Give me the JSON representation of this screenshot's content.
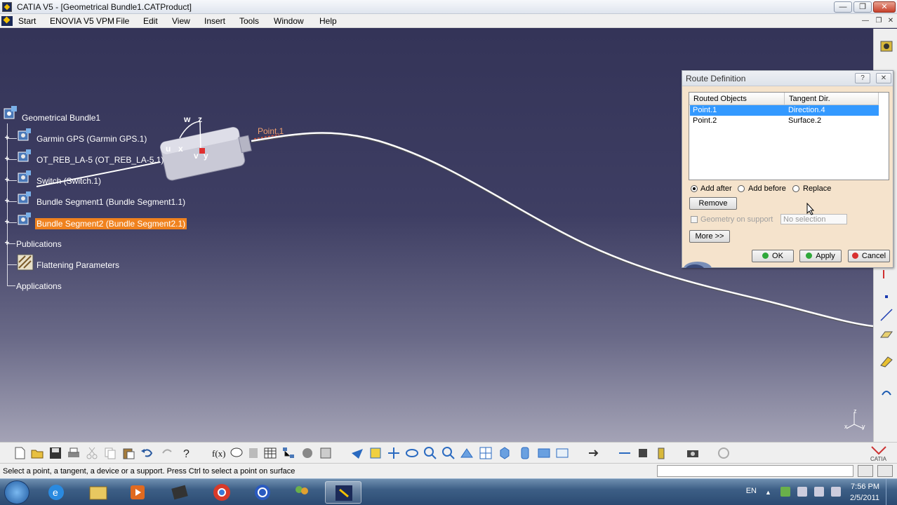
{
  "window": {
    "title": "CATIA V5 - [Geometrical Bundle1.CATProduct]",
    "minimize_glyph": "—",
    "restore_glyph": "❐",
    "close_glyph": "✕"
  },
  "menu": {
    "items": [
      "Start",
      "ENOVIA V5 VPM",
      "File",
      "Edit",
      "View",
      "Insert",
      "Tools",
      "Window",
      "Help"
    ],
    "mdi_min": "—",
    "mdi_restore": "❐",
    "mdi_close": "✕"
  },
  "tree": {
    "root": "Geometrical Bundle1",
    "nodes": [
      "Garmin GPS (Garmin GPS.1)",
      "OT_REB_LA-5 (OT_REB_LA-5.1)",
      "Switch (Switch.1)",
      "Bundle Segment1 (Bundle Segment1.1)",
      "Bundle Segment2 (Bundle Segment2.1)",
      "Publications",
      "Flattening Parameters",
      "Applications"
    ]
  },
  "viewport": {
    "point_label": "Point.1",
    "compass_w": "w",
    "compass_z": "z",
    "compass_u": "u",
    "compass_x": "x",
    "compass_v": "v",
    "compass_y": "y",
    "axis_z": "z",
    "axis_x": "x",
    "axis_y": "y"
  },
  "dialog": {
    "title": "Route Definition",
    "help_glyph": "?",
    "close_glyph": "✕",
    "columns": [
      "Routed Objects",
      "Tangent Dir."
    ],
    "rows": [
      {
        "object": "Point.1",
        "tangent": "Direction.4",
        "selected": true
      },
      {
        "object": "Point.2",
        "tangent": "Surface.2",
        "selected": false
      }
    ],
    "radio_add_after": "Add after",
    "radio_add_before": "Add before",
    "radio_replace": "Replace",
    "remove_label": "Remove",
    "geometry_on_support": "Geometry on support",
    "no_selection": "No selection",
    "more_label": "More >>",
    "ok_label": "OK",
    "apply_label": "Apply",
    "cancel_label": "Cancel"
  },
  "status": {
    "message": "Select a point, a tangent, a device or a support. Press Ctrl to select a point on surface"
  },
  "taskbar": {
    "language": "EN",
    "time": "7:56 PM",
    "date": "2/5/2011"
  },
  "colors": {
    "selection": "#f0821e",
    "list_selection": "#3399ff",
    "dialog_bg": "#f5e3cc"
  }
}
